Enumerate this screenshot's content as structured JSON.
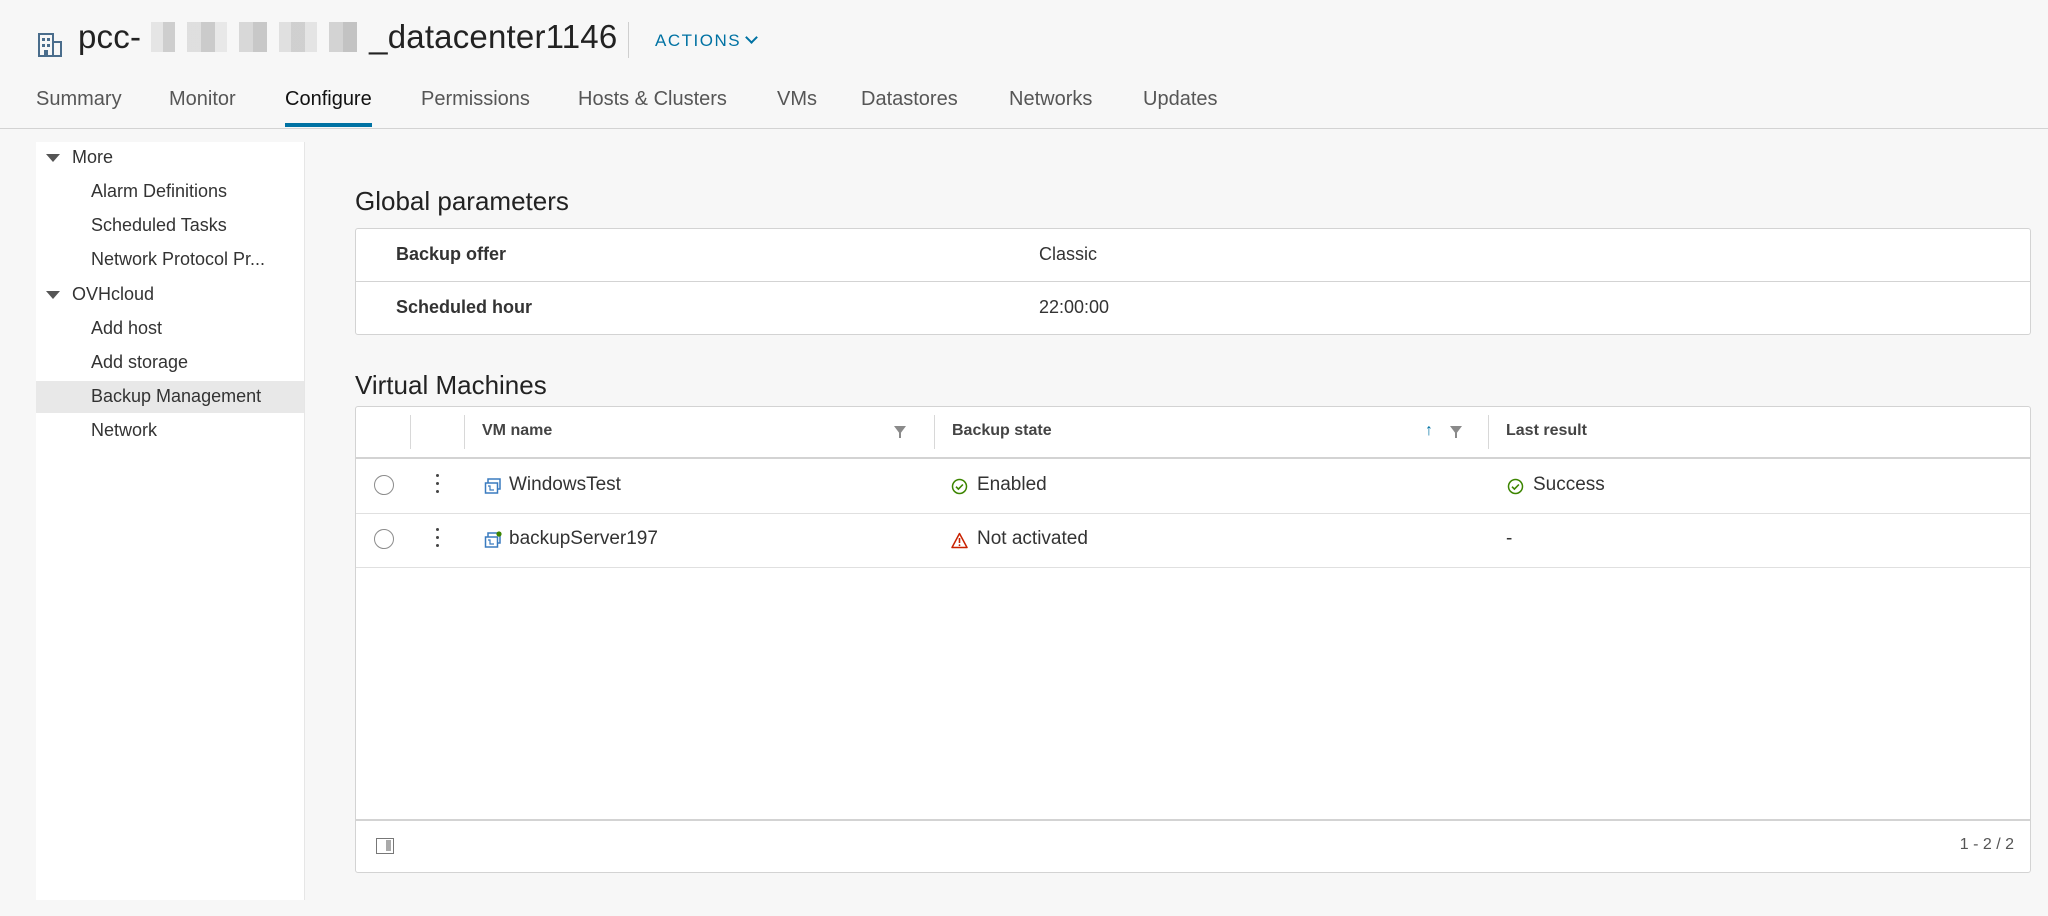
{
  "header": {
    "title_prefix": "pcc-",
    "title_suffix": "_datacenter1146",
    "actions_label": "ACTIONS"
  },
  "tabs": [
    {
      "label": "Summary"
    },
    {
      "label": "Monitor"
    },
    {
      "label": "Configure",
      "active": true
    },
    {
      "label": "Permissions"
    },
    {
      "label": "Hosts & Clusters"
    },
    {
      "label": "VMs"
    },
    {
      "label": "Datastores"
    },
    {
      "label": "Networks"
    },
    {
      "label": "Updates"
    }
  ],
  "sidebar": {
    "groups": [
      {
        "label": "More",
        "items": [
          "Alarm Definitions",
          "Scheduled Tasks",
          "Network Protocol Pr..."
        ]
      },
      {
        "label": "OVHcloud",
        "items": [
          "Add host",
          "Add storage",
          "Backup Management",
          "Network"
        ]
      }
    ],
    "selected": "Backup Management"
  },
  "global_parameters": {
    "title": "Global parameters",
    "rows": [
      {
        "key": "Backup offer",
        "value": "Classic"
      },
      {
        "key": "Scheduled hour",
        "value": "22:00:00"
      }
    ]
  },
  "virtual_machines": {
    "title": "Virtual Machines",
    "columns": [
      "VM name",
      "Backup state",
      "Last result"
    ],
    "rows": [
      {
        "vm_name": "WindowsTest",
        "backup_state": "Enabled",
        "last_result": "Success"
      },
      {
        "vm_name": "backupServer197",
        "backup_state": "Not activated",
        "last_result": "-"
      }
    ],
    "pagination": "1 - 2 / 2"
  },
  "colors": {
    "accent": "#0072a3",
    "success": "#3c8500",
    "warning": "#c92100"
  },
  "icons": {
    "datacenter": "building-icon",
    "vm": "vm-icon",
    "enabled": "check-circle-icon",
    "not_activated": "warning-triangle-icon"
  }
}
